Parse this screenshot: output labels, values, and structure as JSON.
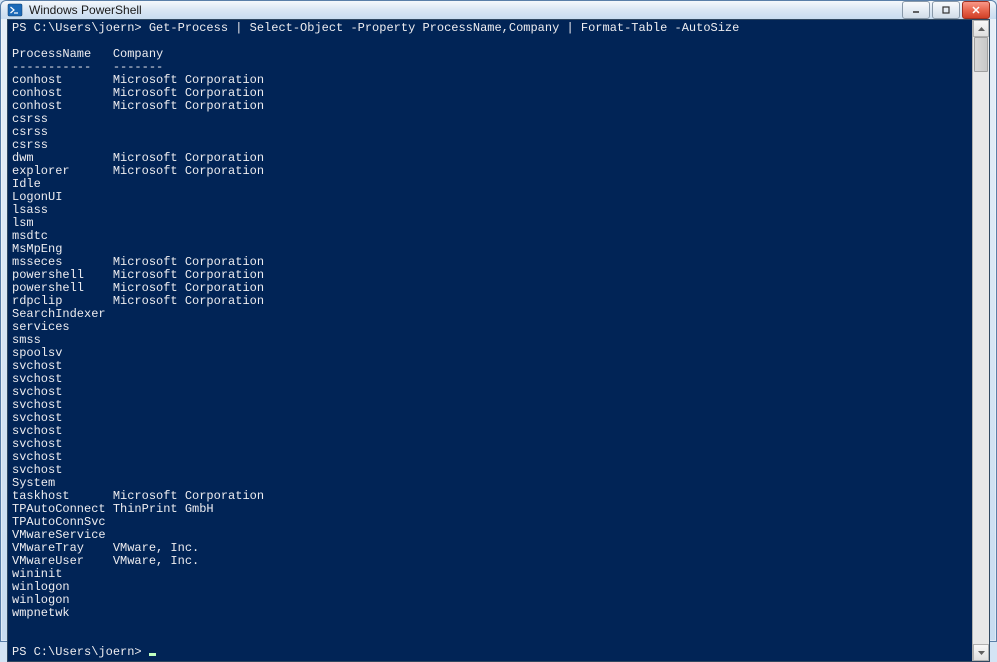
{
  "window": {
    "title": "Windows PowerShell"
  },
  "terminal": {
    "prompt": "PS C:\\Users\\joern>",
    "command": "Get-Process | Select-Object -Property ProcessName,Company | Format-Table -AutoSize",
    "headers": {
      "col1": "ProcessName",
      "col2": "Company"
    },
    "underline": {
      "col1": "-----------",
      "col2": "-------"
    },
    "rows": [
      {
        "name": "conhost",
        "company": "Microsoft Corporation"
      },
      {
        "name": "conhost",
        "company": "Microsoft Corporation"
      },
      {
        "name": "conhost",
        "company": "Microsoft Corporation"
      },
      {
        "name": "csrss",
        "company": ""
      },
      {
        "name": "csrss",
        "company": ""
      },
      {
        "name": "csrss",
        "company": ""
      },
      {
        "name": "dwm",
        "company": "Microsoft Corporation"
      },
      {
        "name": "explorer",
        "company": "Microsoft Corporation"
      },
      {
        "name": "Idle",
        "company": ""
      },
      {
        "name": "LogonUI",
        "company": ""
      },
      {
        "name": "lsass",
        "company": ""
      },
      {
        "name": "lsm",
        "company": ""
      },
      {
        "name": "msdtc",
        "company": ""
      },
      {
        "name": "MsMpEng",
        "company": ""
      },
      {
        "name": "msseces",
        "company": "Microsoft Corporation"
      },
      {
        "name": "powershell",
        "company": "Microsoft Corporation"
      },
      {
        "name": "powershell",
        "company": "Microsoft Corporation"
      },
      {
        "name": "rdpclip",
        "company": "Microsoft Corporation"
      },
      {
        "name": "SearchIndexer",
        "company": ""
      },
      {
        "name": "services",
        "company": ""
      },
      {
        "name": "smss",
        "company": ""
      },
      {
        "name": "spoolsv",
        "company": ""
      },
      {
        "name": "svchost",
        "company": ""
      },
      {
        "name": "svchost",
        "company": ""
      },
      {
        "name": "svchost",
        "company": ""
      },
      {
        "name": "svchost",
        "company": ""
      },
      {
        "name": "svchost",
        "company": ""
      },
      {
        "name": "svchost",
        "company": ""
      },
      {
        "name": "svchost",
        "company": ""
      },
      {
        "name": "svchost",
        "company": ""
      },
      {
        "name": "svchost",
        "company": ""
      },
      {
        "name": "System",
        "company": ""
      },
      {
        "name": "taskhost",
        "company": "Microsoft Corporation"
      },
      {
        "name": "TPAutoConnect",
        "company": "ThinPrint GmbH"
      },
      {
        "name": "TPAutoConnSvc",
        "company": ""
      },
      {
        "name": "VMwareService",
        "company": ""
      },
      {
        "name": "VMwareTray",
        "company": "VMware, Inc."
      },
      {
        "name": "VMwareUser",
        "company": "VMware, Inc."
      },
      {
        "name": "wininit",
        "company": ""
      },
      {
        "name": "winlogon",
        "company": ""
      },
      {
        "name": "winlogon",
        "company": ""
      },
      {
        "name": "wmpnetwk",
        "company": ""
      }
    ],
    "colwidth_name": 14
  }
}
